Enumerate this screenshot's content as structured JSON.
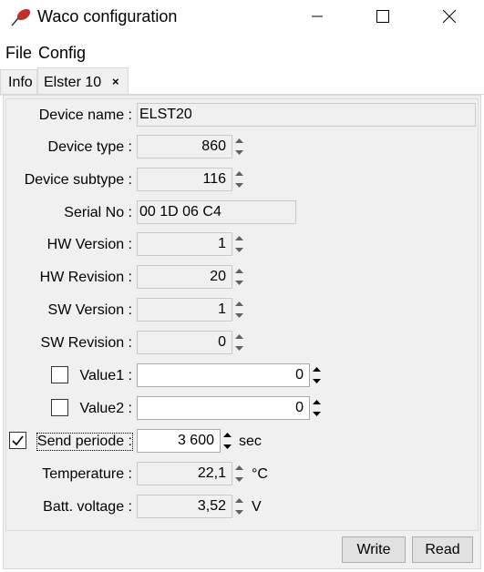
{
  "window": {
    "title": "Waco configuration"
  },
  "menu": {
    "file": "File",
    "config": "Config"
  },
  "tabs": [
    {
      "label": "Info"
    },
    {
      "label": "Elster 10",
      "close": "×"
    }
  ],
  "fields": {
    "device_name": {
      "label": "Device name :",
      "value": "ELST20"
    },
    "device_type": {
      "label": "Device type :",
      "value": "860"
    },
    "device_subtype": {
      "label": "Device subtype :",
      "value": "116"
    },
    "serial_no": {
      "label": "Serial No :",
      "value": "00 1D 06 C4"
    },
    "hw_version": {
      "label": "HW Version :",
      "value": "1"
    },
    "hw_revision": {
      "label": "HW Revision :",
      "value": "20"
    },
    "sw_version": {
      "label": "SW Version :",
      "value": "1"
    },
    "sw_revision": {
      "label": "SW Revision :",
      "value": "0"
    },
    "value1": {
      "label": "Value1 :",
      "value": "0",
      "checked": false
    },
    "value2": {
      "label": "Value2 :",
      "value": "0",
      "checked": false
    },
    "send_periode": {
      "label": "Send periode :",
      "value": "3 600",
      "unit": "sec",
      "checked": true
    },
    "temperature": {
      "label": "Temperature :",
      "value": "22,1",
      "unit": "°C"
    },
    "batt_voltage": {
      "label": "Batt. voltage :",
      "value": "3,52",
      "unit": "V"
    }
  },
  "buttons": {
    "write": "Write",
    "read": "Read"
  }
}
